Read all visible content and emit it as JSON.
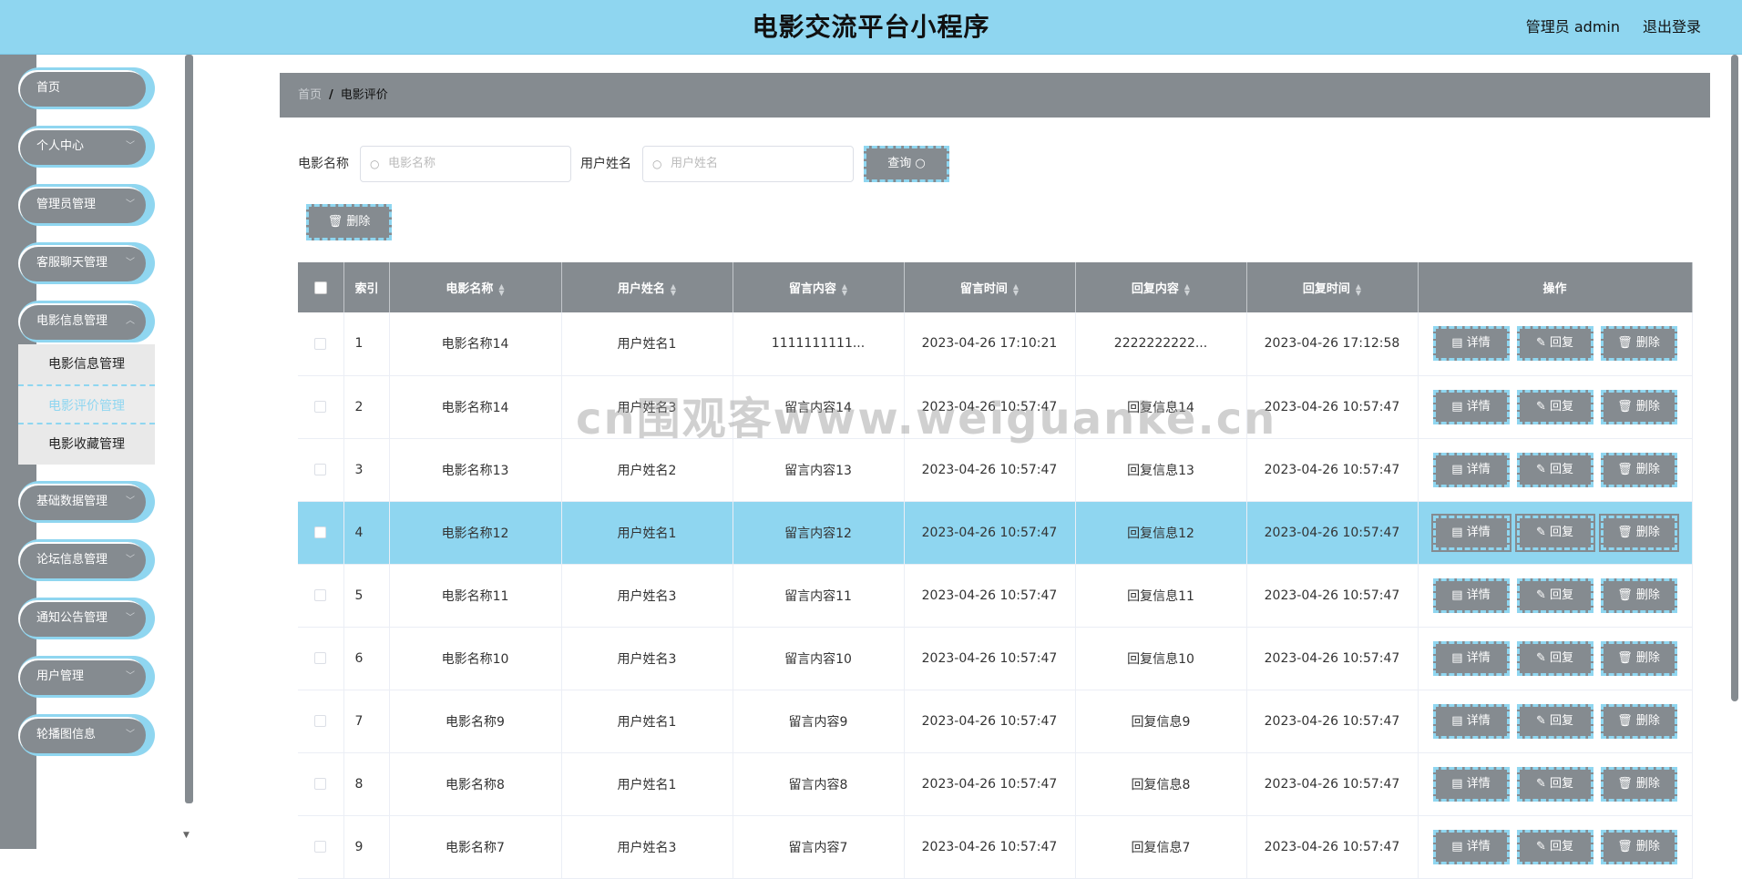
{
  "header": {
    "title": "电影交流平台小程序",
    "user_label": "管理员 admin",
    "logout_label": "退出登录"
  },
  "sidebar": {
    "items": [
      {
        "label": "首页",
        "has_children": false
      },
      {
        "label": "个人中心",
        "has_children": true
      },
      {
        "label": "管理员管理",
        "has_children": true
      },
      {
        "label": "客服聊天管理",
        "has_children": true
      },
      {
        "label": "电影信息管理",
        "has_children": true,
        "expanded": true,
        "children": [
          {
            "label": "电影信息管理",
            "active": false
          },
          {
            "label": "电影评价管理",
            "active": true
          },
          {
            "label": "电影收藏管理",
            "active": false
          }
        ]
      },
      {
        "label": "基础数据管理",
        "has_children": true
      },
      {
        "label": "论坛信息管理",
        "has_children": true
      },
      {
        "label": "通知公告管理",
        "has_children": true
      },
      {
        "label": "用户管理",
        "has_children": true
      },
      {
        "label": "轮播图信息",
        "has_children": true
      }
    ]
  },
  "breadcrumb": {
    "home": "首页",
    "separator": "/",
    "current": "电影评价"
  },
  "search": {
    "movie_label": "电影名称",
    "movie_placeholder": "电影名称",
    "user_label": "用户姓名",
    "user_placeholder": "用户姓名",
    "query_button": "查询"
  },
  "toolbar": {
    "delete_button": "删除"
  },
  "table": {
    "columns": [
      "索引",
      "电影名称",
      "用户姓名",
      "留言内容",
      "留言时间",
      "回复内容",
      "回复时间",
      "操作"
    ],
    "actions": {
      "detail": "详情",
      "reply": "回复",
      "delete": "删除"
    },
    "rows": [
      {
        "index": "1",
        "movie": "电影名称14",
        "user": "用户姓名1",
        "message": "1111111111...",
        "msg_time": "2023-04-26 17:10:21",
        "reply": "2222222222...",
        "reply_time": "2023-04-26 17:12:58",
        "highlight": false
      },
      {
        "index": "2",
        "movie": "电影名称14",
        "user": "用户姓名3",
        "message": "留言内容14",
        "msg_time": "2023-04-26 10:57:47",
        "reply": "回复信息14",
        "reply_time": "2023-04-26 10:57:47",
        "highlight": false
      },
      {
        "index": "3",
        "movie": "电影名称13",
        "user": "用户姓名2",
        "message": "留言内容13",
        "msg_time": "2023-04-26 10:57:47",
        "reply": "回复信息13",
        "reply_time": "2023-04-26 10:57:47",
        "highlight": false
      },
      {
        "index": "4",
        "movie": "电影名称12",
        "user": "用户姓名1",
        "message": "留言内容12",
        "msg_time": "2023-04-26 10:57:47",
        "reply": "回复信息12",
        "reply_time": "2023-04-26 10:57:47",
        "highlight": true
      },
      {
        "index": "5",
        "movie": "电影名称11",
        "user": "用户姓名3",
        "message": "留言内容11",
        "msg_time": "2023-04-26 10:57:47",
        "reply": "回复信息11",
        "reply_time": "2023-04-26 10:57:47",
        "highlight": false
      },
      {
        "index": "6",
        "movie": "电影名称10",
        "user": "用户姓名3",
        "message": "留言内容10",
        "msg_time": "2023-04-26 10:57:47",
        "reply": "回复信息10",
        "reply_time": "2023-04-26 10:57:47",
        "highlight": false
      },
      {
        "index": "7",
        "movie": "电影名称9",
        "user": "用户姓名1",
        "message": "留言内容9",
        "msg_time": "2023-04-26 10:57:47",
        "reply": "回复信息9",
        "reply_time": "2023-04-26 10:57:47",
        "highlight": false
      },
      {
        "index": "8",
        "movie": "电影名称8",
        "user": "用户姓名1",
        "message": "留言内容8",
        "msg_time": "2023-04-26 10:57:47",
        "reply": "回复信息8",
        "reply_time": "2023-04-26 10:57:47",
        "highlight": false
      },
      {
        "index": "9",
        "movie": "电影名称7",
        "user": "用户姓名3",
        "message": "留言内容7",
        "msg_time": "2023-04-26 10:57:47",
        "reply": "回复信息7",
        "reply_time": "2023-04-26 10:57:47",
        "highlight": false
      }
    ]
  },
  "watermark": "cn围观客www.weiguanke.cn",
  "colors": {
    "accent": "#8fd6f0",
    "gray": "#858b90",
    "submenu_bg": "#e9e9e9"
  }
}
